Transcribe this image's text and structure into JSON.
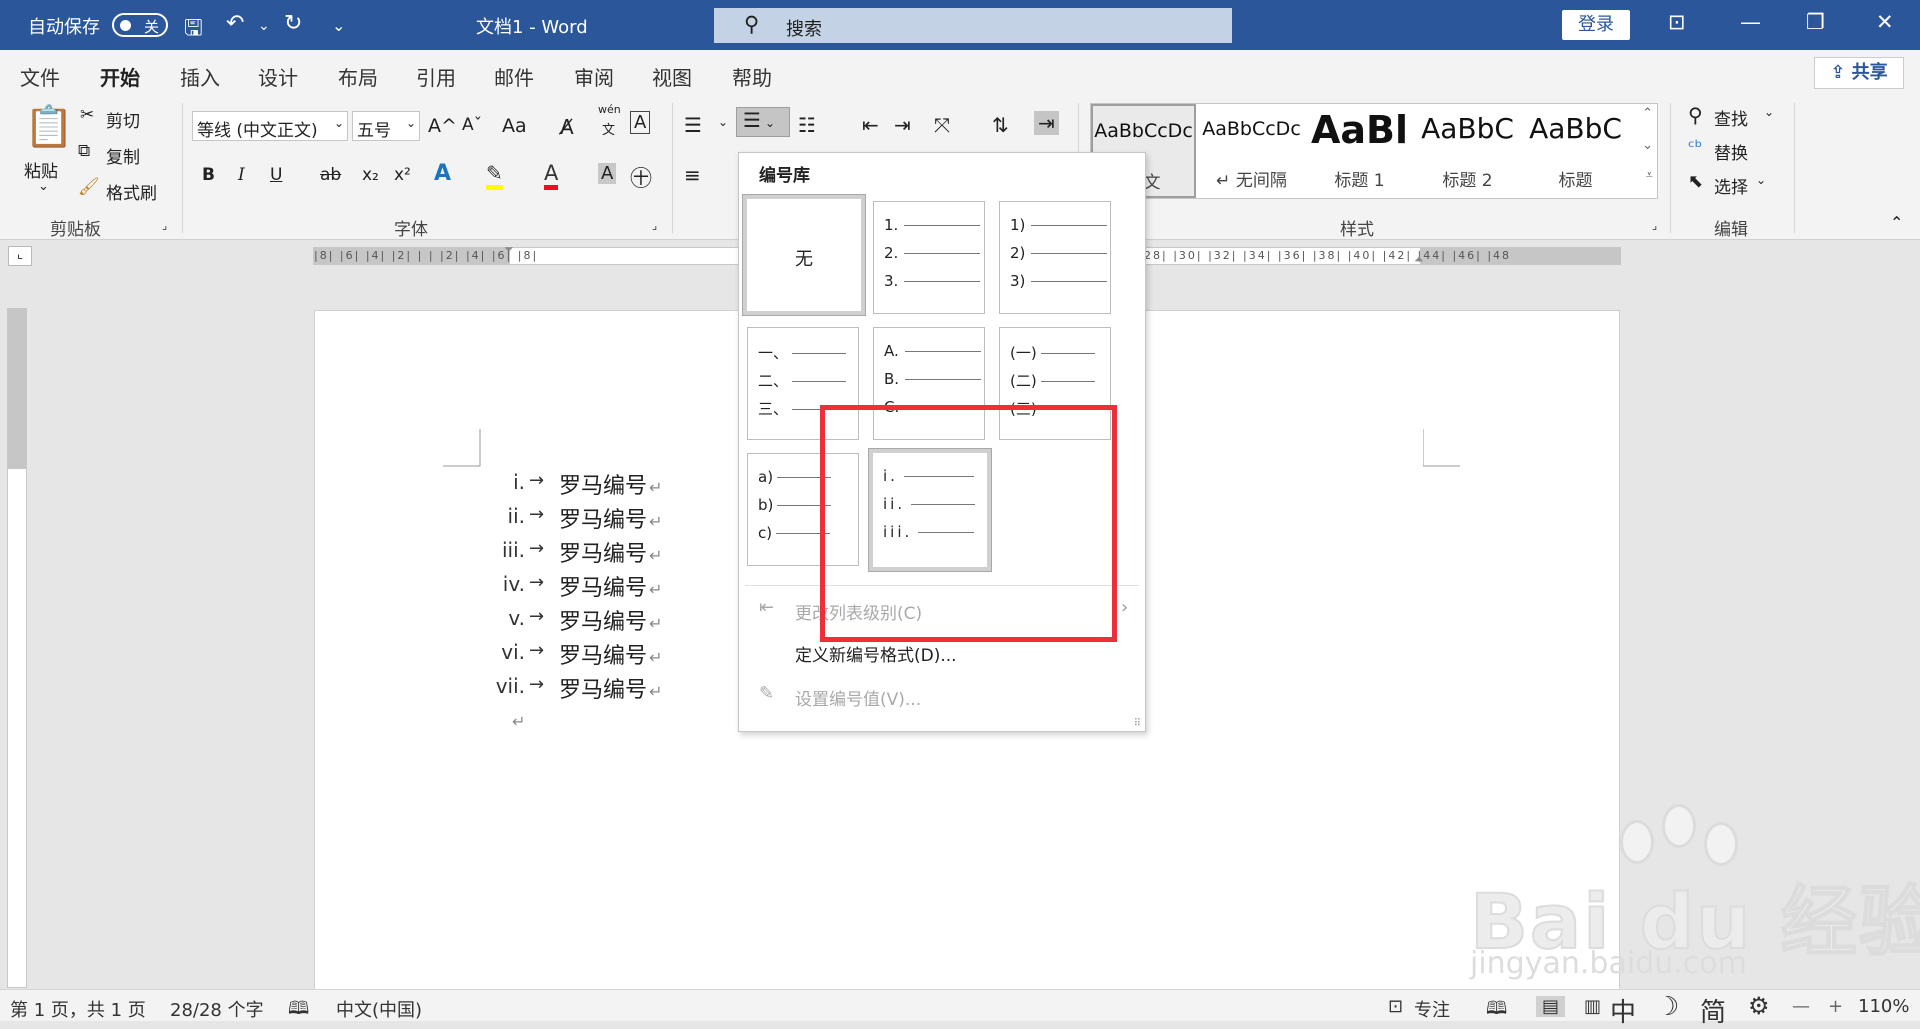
{
  "titlebar": {
    "autosave_label": "自动保存",
    "autosave_state": "关",
    "doc_title": "文档1  -  Word",
    "search_placeholder": "搜索",
    "login_label": "登录",
    "colors": {
      "bar": "#2b579a"
    }
  },
  "tabs": [
    {
      "label": "文件"
    },
    {
      "label": "开始"
    },
    {
      "label": "插入"
    },
    {
      "label": "设计"
    },
    {
      "label": "布局"
    },
    {
      "label": "引用"
    },
    {
      "label": "邮件"
    },
    {
      "label": "审阅"
    },
    {
      "label": "视图"
    },
    {
      "label": "帮助"
    }
  ],
  "share_label": "共享",
  "clipboard": {
    "paste": "粘贴",
    "cut": "剪切",
    "copy": "复制",
    "format_painter": "格式刷",
    "group": "剪贴板"
  },
  "font": {
    "family": "等线 (中文正文)",
    "size": "五号",
    "group": "字体",
    "bold": "B",
    "italic": "I",
    "underline": "U",
    "strike": "ab",
    "sub": "x₂",
    "sup": "x²",
    "grow": "A^",
    "shrink": "Aˇ",
    "case": "Aa",
    "pinyin_top": "wén",
    "pinyin_bottom": "文"
  },
  "styles": {
    "group": "样式",
    "items": [
      {
        "preview": "AaBbCcDc",
        "name": "正文"
      },
      {
        "preview": "AaBbCcDc",
        "name": "↵ 无间隔"
      },
      {
        "preview": "AaBl",
        "name": "标题 1"
      },
      {
        "preview": "AaBbC",
        "name": "标题 2"
      },
      {
        "preview": "AaBbC",
        "name": "标题"
      }
    ]
  },
  "editing": {
    "find": "查找",
    "replace": "替换",
    "select": "选择",
    "group": "编辑"
  },
  "ruler": {
    "numbers": "|8| |6| |4| |2| | | |2| |4| |6| |8|",
    "numbers_right": "28| |30| |32| |34| |36| |38| |40| |42| |44| |46| |48"
  },
  "document": {
    "items": [
      {
        "num": "i.",
        "text": "罗马编号"
      },
      {
        "num": "ii.",
        "text": "罗马编号"
      },
      {
        "num": "iii.",
        "text": "罗马编号"
      },
      {
        "num": "iv.",
        "text": "罗马编号"
      },
      {
        "num": "v.",
        "text": "罗马编号"
      },
      {
        "num": "vi.",
        "text": "罗马编号"
      },
      {
        "num": "vii.",
        "text": "罗马编号"
      }
    ],
    "arrow": "→",
    "pilcrow": "↵"
  },
  "numbering_menu": {
    "title": "编号库",
    "none": "无",
    "lib_decimal": [
      "1.",
      "2.",
      "3."
    ],
    "lib_paren": [
      "1)",
      "2)",
      "3)"
    ],
    "lib_chinese": [
      "一、",
      "二、",
      "三、"
    ],
    "lib_upper": [
      "A.",
      "B.",
      "C."
    ],
    "lib_chinese_paren": [
      "(一)",
      "(二)",
      "(三)"
    ],
    "lib_lower": [
      "a)",
      "b)",
      "c)"
    ],
    "lib_roman": [
      "i.",
      "ii.",
      "iii."
    ],
    "change_level": "更改列表级别(C)",
    "define_new": "定义新编号格式(D)...",
    "set_value": "设置编号值(V)...",
    "highlight_color": "#ec2f3a"
  },
  "status": {
    "page": "第 1 页，共 1 页",
    "words": "28/28 个字",
    "language": "中文(中国)",
    "focus": "专注",
    "ime_lang": "中",
    "ime_simp": "简",
    "zoom": "110%"
  },
  "watermark": {
    "brand": "Bai  du 经验",
    "url": "jingyan.baidu.com"
  }
}
